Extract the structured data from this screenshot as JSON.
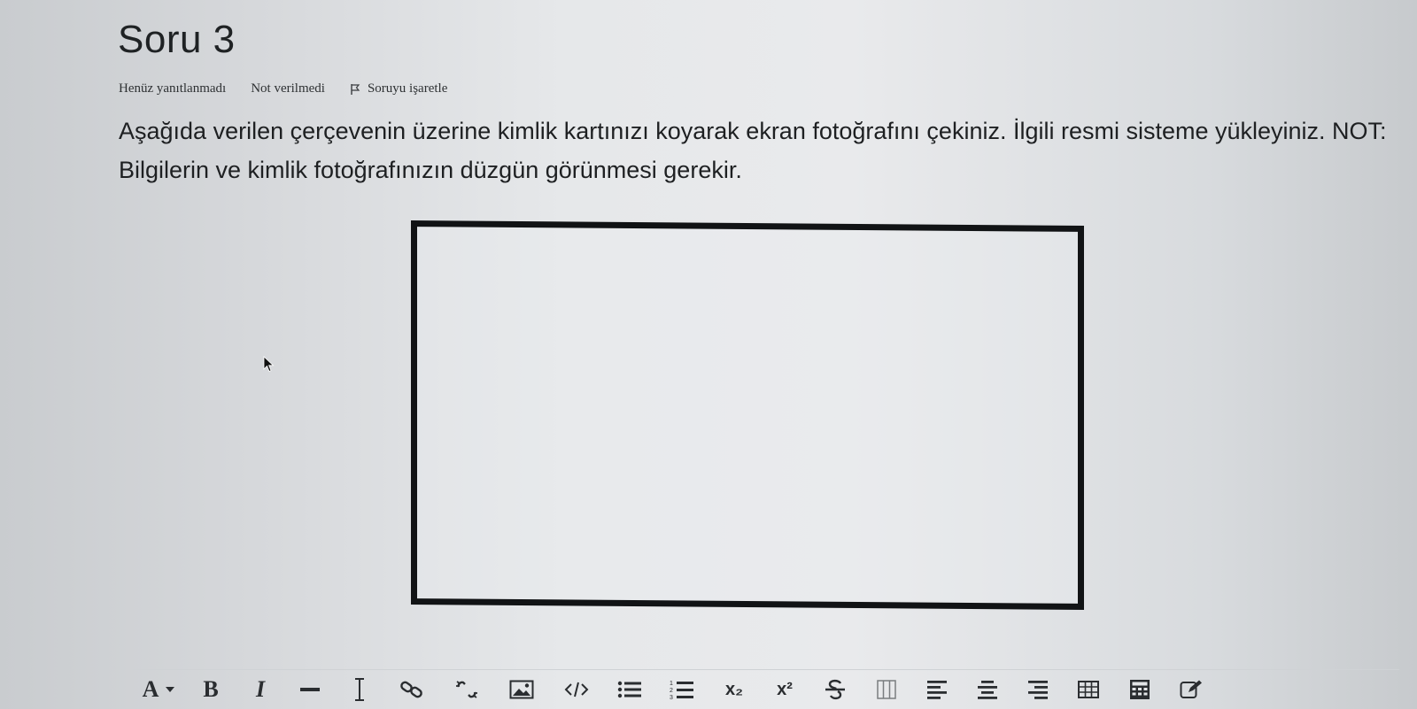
{
  "question": {
    "title": "Soru 3",
    "status": "Henüz yanıtlanmadı",
    "grade": "Not verilmedi",
    "flag_label": "Soruyu işaretle",
    "text": "Aşağıda verilen çerçevenin üzerine kimlik kartınızı koyarak ekran fotoğrafını çekiniz. İlgili resmi sisteme yükleyiniz. NOT: Bilgilerin ve kimlik fotoğrafınızın düzgün görünmesi gerekir."
  },
  "toolbar": {
    "font_color_label": "A",
    "bold_label": "B",
    "italic_label": "I",
    "subscript_label": "x₂",
    "superscript_label": "x²",
    "buttons": [
      "font-color",
      "bold",
      "italic",
      "horizontal-rule",
      "text-cursor",
      "link",
      "unlink",
      "image",
      "code",
      "bullet-list",
      "numbered-list",
      "subscript",
      "superscript",
      "strikethrough",
      "columns",
      "align-left",
      "align-center",
      "align-right",
      "table",
      "calculator",
      "edit"
    ]
  },
  "colors": {
    "text": "#1e2022",
    "frame_border": "#111315"
  }
}
